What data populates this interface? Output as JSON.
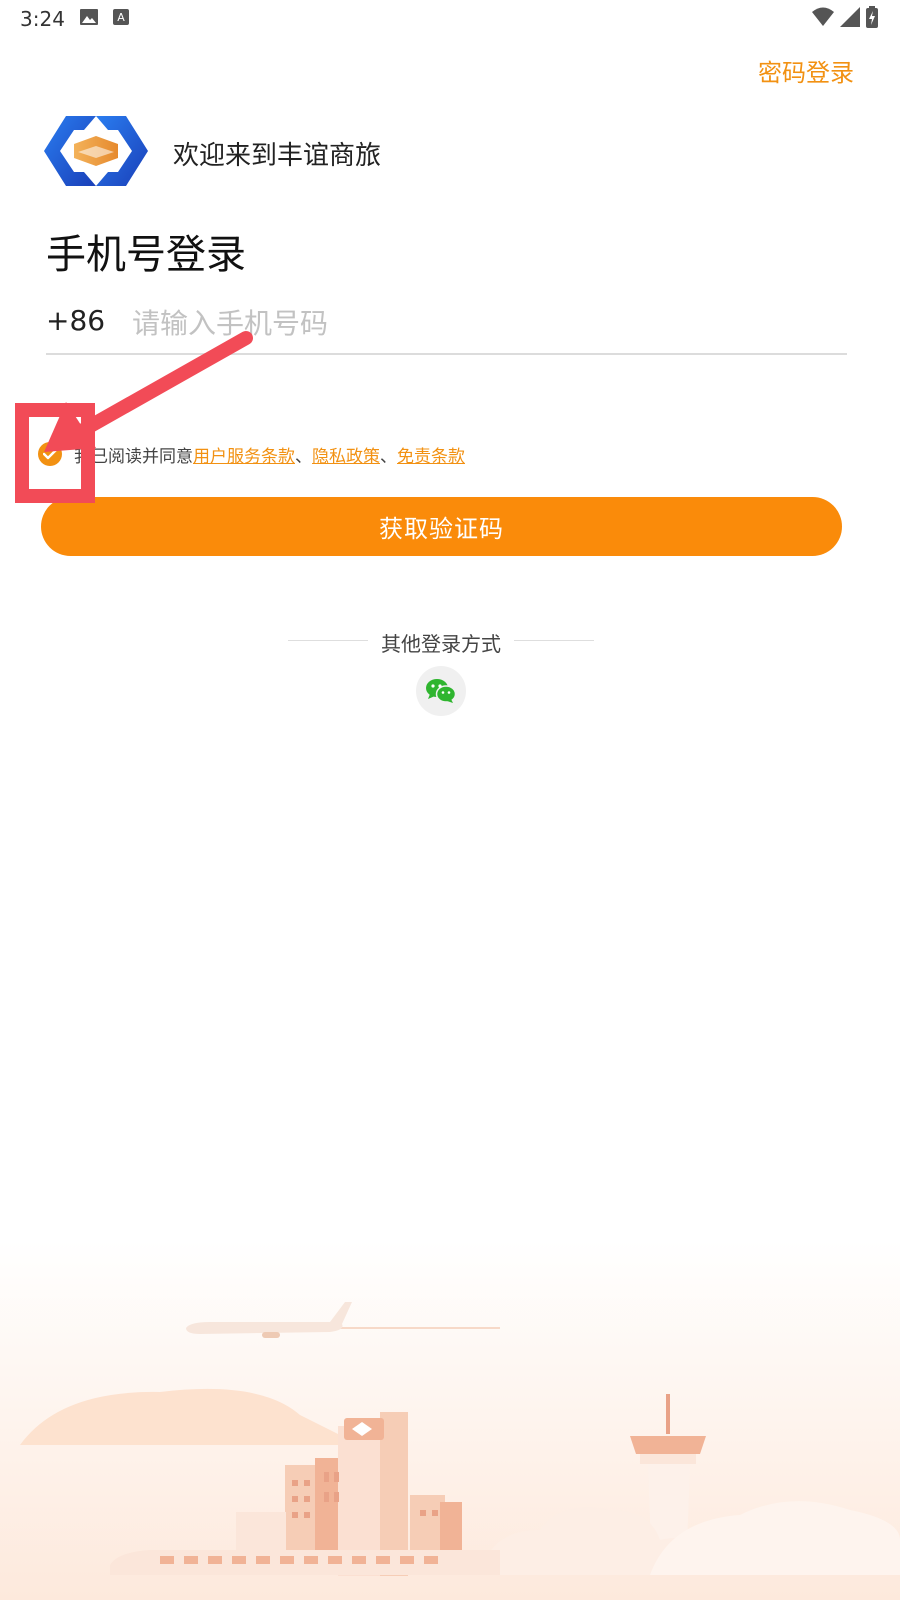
{
  "status_bar": {
    "time": "3:24"
  },
  "header": {
    "password_login": "密码登录",
    "welcome": "欢迎来到丰谊商旅",
    "title": "手机号登录"
  },
  "phone": {
    "country_code": "+86",
    "placeholder": "请输入手机号码"
  },
  "agreement": {
    "prefix": "我已阅读并同意",
    "link_terms": "用户服务条款",
    "sep1": "、",
    "link_privacy": "隐私政策",
    "sep2": "、",
    "link_disclaimer": "免责条款"
  },
  "actions": {
    "get_code": "获取验证码"
  },
  "other_login": {
    "label": "其他登录方式"
  },
  "colors": {
    "accent": "#fa8b0a",
    "link": "#f29112",
    "annotation": "#f24b57"
  }
}
